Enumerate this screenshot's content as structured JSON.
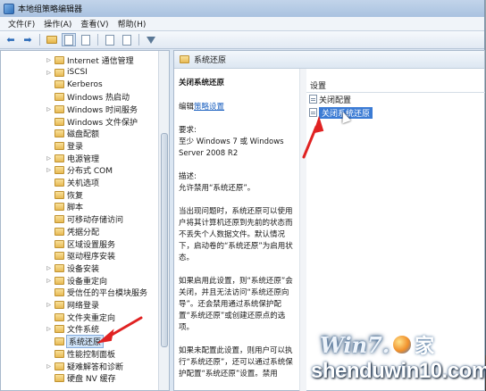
{
  "window": {
    "title": "本地组策略编辑器"
  },
  "menubar": {
    "items": [
      "文件(F)",
      "操作(A)",
      "查看(V)",
      "帮助(H)"
    ]
  },
  "toolbar": {
    "buttons": [
      "back-icon",
      "forward-icon",
      "up-folder-icon",
      "show-hide-tree-icon",
      "export-list-icon",
      "properties-icon",
      "help-icon",
      "filter-icon"
    ]
  },
  "tree": {
    "items": [
      {
        "label": "Internet 通信管理",
        "expandable": true
      },
      {
        "label": "iSCSI",
        "expandable": true
      },
      {
        "label": "Kerberos",
        "expandable": false
      },
      {
        "label": "Windows 热启动",
        "expandable": false
      },
      {
        "label": "Windows 时间服务",
        "expandable": true
      },
      {
        "label": "Windows 文件保护",
        "expandable": false
      },
      {
        "label": "磁盘配额",
        "expandable": false
      },
      {
        "label": "登录",
        "expandable": false
      },
      {
        "label": "电源管理",
        "expandable": true
      },
      {
        "label": "分布式 COM",
        "expandable": true
      },
      {
        "label": "关机选项",
        "expandable": false
      },
      {
        "label": "恢复",
        "expandable": false
      },
      {
        "label": "脚本",
        "expandable": false
      },
      {
        "label": "可移动存储访问",
        "expandable": false
      },
      {
        "label": "凭据分配",
        "expandable": false
      },
      {
        "label": "区域设置服务",
        "expandable": false
      },
      {
        "label": "驱动程序安装",
        "expandable": false
      },
      {
        "label": "设备安装",
        "expandable": true
      },
      {
        "label": "设备重定向",
        "expandable": true
      },
      {
        "label": "受信任的平台模块服务",
        "expandable": false
      },
      {
        "label": "网络登录",
        "expandable": true
      },
      {
        "label": "文件夹重定向",
        "expandable": false
      },
      {
        "label": "文件系统",
        "expandable": true
      },
      {
        "label": "系统还原",
        "expandable": false,
        "selected": true
      },
      {
        "label": "性能控制面板",
        "expandable": false
      },
      {
        "label": "疑难解答和诊断",
        "expandable": true
      },
      {
        "label": "硬盘 NV 缓存",
        "expandable": false
      }
    ]
  },
  "right": {
    "header": "系统还原",
    "description": {
      "title": "关闭系统还原",
      "edit_prefix": "编辑",
      "edit_link": "策略设置",
      "requirements_label": "要求:",
      "requirements_text": "至少 Windows 7 或 Windows Server 2008 R2",
      "desc_label": "描述:",
      "desc_text": "允许禁用“系统还原”。",
      "para1": "当出现问题时，系统还原可以使用户将其计算机还原到先前的状态而不丢失个人数据文件。默认情况下，启动卷的“系统还原”为启用状态。",
      "para2": "如果启用此设置，则“系统还原”会关闭，并且无法访问“系统还原向导”。还会禁用通过系统保护配置“系统还原”或创建还原点的选项。",
      "para3": "如果未配置此设置，则用户可以执行“系统还原”，还可以通过系统保护配置“系统还原”设置。禁用"
    },
    "settings": {
      "header": "设置",
      "rows": [
        {
          "label": "关闭配置",
          "selected": false
        },
        {
          "label": "关闭系统还原",
          "selected": true
        }
      ]
    }
  },
  "watermark": {
    "brand_text": "Win7.",
    "jia": "家",
    "url": "shenduwin10.com"
  },
  "colors": {
    "annotation_arrow": "#e02222",
    "selection": "#3b7bd4"
  }
}
